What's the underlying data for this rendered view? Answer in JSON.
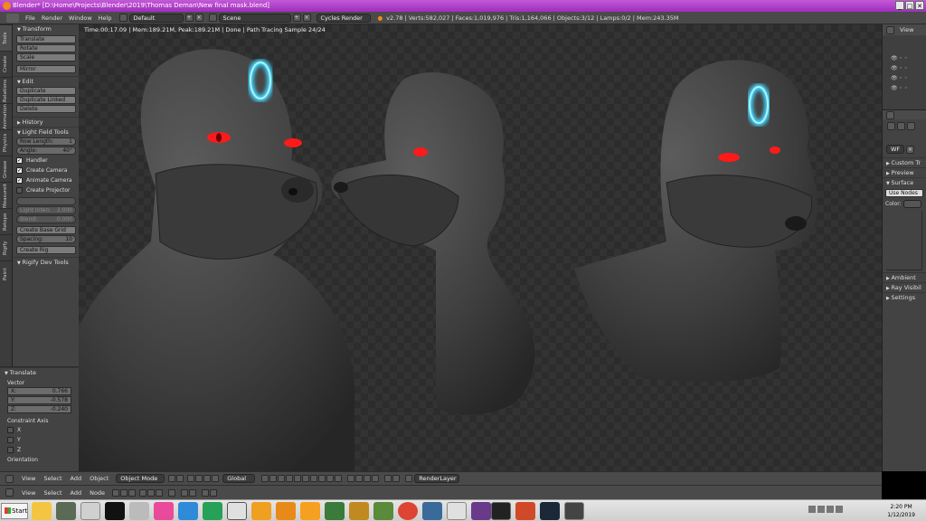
{
  "titlebar": {
    "title": "Blender* [D:\\Home\\Projects\\Blender\\2019\\Thomas Deman\\New final mask.blend]",
    "min": "_",
    "max": "□",
    "close": "✕"
  },
  "infobar": {
    "menus": [
      "File",
      "Render",
      "Window",
      "Help"
    ],
    "layout": "Default",
    "scene": "Scene",
    "engine": "Cycles Render",
    "stats": "v2.78 | Verts:582,027 | Faces:1,019,976 | Tris:1,164,066 | Objects:3/12 | Lamps:0/2 | Mem:243.35M"
  },
  "viewport": {
    "status": "Time:00:17.09 | Mem:189.21M, Peak:189.21M | Done | Path Tracing Sample 24/24"
  },
  "left_tabs": [
    "Tools",
    "Create",
    "Relations",
    "Animation",
    "Physics",
    "Grease Pencil",
    "Measureit",
    "Retopo",
    "Rigify",
    "Paint Tools"
  ],
  "toolshelf": {
    "transform_header": "Transform",
    "transform_buttons": [
      "Translate",
      "Rotate",
      "Scale"
    ],
    "mirror": "Mirror",
    "edit_header": "Edit",
    "edit_buttons": [
      "Duplicate",
      "Duplicate Linked",
      "Delete"
    ],
    "history_header": "History",
    "lightfield_header": "Light Field Tools",
    "row_length_label": "Row Length:",
    "row_length_value": "1",
    "angle_label": "Angle:",
    "angle_value": "40°",
    "handler": "Handler",
    "create_camera": "Create Camera",
    "animate_camera": "Animate Camera",
    "create_projector": "Create Projector",
    "light_intensity_label": "Light Inten:",
    "light_intensity_value": "2.000",
    "blend_label": "Blend:",
    "blend_value": "0.000",
    "create_base_grid": "Create Base Grid",
    "spacing_label": "Spacing:",
    "spacing_value": "10",
    "create_rig": "Create Rig",
    "rigify_header": "Rigify Dev Tools"
  },
  "operator": {
    "header": "Translate",
    "vector_label": "Vector",
    "x": {
      "label": "X:",
      "value": "0.766"
    },
    "y": {
      "label": "Y:",
      "value": "-0.578"
    },
    "z": {
      "label": "Z:",
      "value": "-0.240"
    },
    "constraint_label": "Constraint Axis",
    "axes": [
      "X",
      "Y",
      "Z"
    ],
    "orientation_label": "Orientation"
  },
  "outliner": {
    "view": "View"
  },
  "props": {
    "material_abbrev": "WF",
    "panels": [
      "Custom Tr",
      "Preview",
      "Surface"
    ],
    "use_nodes": "Use Nodes",
    "color_label": "Color:",
    "lower_panels": [
      "Ambient",
      "Ray Visibil",
      "Settings"
    ]
  },
  "view3d_header": {
    "menus": [
      "View",
      "Select",
      "Add",
      "Object"
    ],
    "mode": "Object Mode",
    "orientation": "Global",
    "render_layer": "RenderLayer"
  },
  "node_header": {
    "menus": [
      "View",
      "Select",
      "Add",
      "Node"
    ]
  },
  "taskbar": {
    "start": "Start",
    "time": "2:20 PM",
    "date": "1/12/2019"
  },
  "colors": {
    "title_purple": "#a02cc0",
    "glow_cyan": "#3fd8ff",
    "eye_red": "#ff1a1a"
  }
}
